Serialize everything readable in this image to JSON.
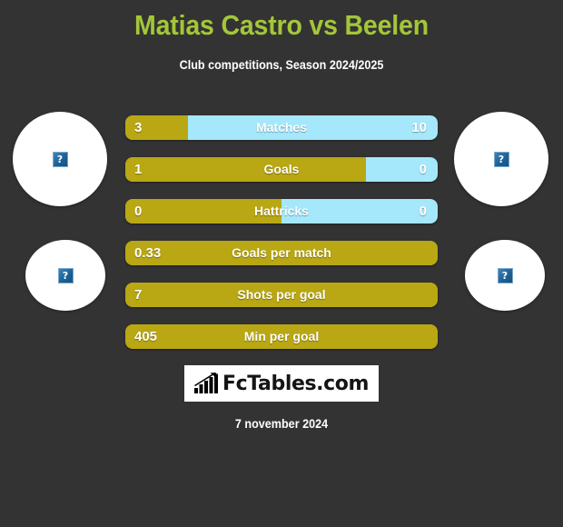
{
  "header": {
    "title": "Matias Castro vs Beelen",
    "subtitle": "Club competitions, Season 2024/2025",
    "title_color": "#a4c639",
    "background_color": "#333333"
  },
  "colors": {
    "home_bar": "#b9a713",
    "away_bar": "#a5e7fb",
    "text": "#ffffff"
  },
  "avatars": [
    {
      "position": "home-top",
      "icon": "broken-image-icon",
      "glyph": "?"
    },
    {
      "position": "away-top",
      "icon": "broken-image-icon",
      "glyph": "?"
    },
    {
      "position": "home-bottom",
      "icon": "broken-image-icon",
      "glyph": "?"
    },
    {
      "position": "away-bottom",
      "icon": "broken-image-icon",
      "glyph": "?"
    }
  ],
  "chart_data": {
    "type": "bar",
    "title": "Matias Castro vs Beelen",
    "subtitle": "Club competitions, Season 2024/2025",
    "orientation": "horizontal-diverging",
    "categories": [
      "Matches",
      "Goals",
      "Hattricks",
      "Goals per match",
      "Shots per goal",
      "Min per goal"
    ],
    "series": [
      {
        "name": "Matias Castro",
        "values": [
          "3",
          "1",
          "0",
          "0.33",
          "7",
          "405"
        ],
        "color": "#b9a713"
      },
      {
        "name": "Beelen",
        "values": [
          "10",
          "0",
          "0",
          "",
          "",
          ""
        ],
        "color": "#a5e7fb"
      }
    ],
    "fill_percent": [
      20,
      77,
      50,
      100,
      100,
      100
    ],
    "grid": false,
    "legend": "none"
  },
  "stats": [
    {
      "label": "Matches",
      "left_value": "3",
      "right_value": "10",
      "fill_percent": 20,
      "has_right": true
    },
    {
      "label": "Goals",
      "left_value": "1",
      "right_value": "0",
      "fill_percent": 77,
      "has_right": true
    },
    {
      "label": "Hattricks",
      "left_value": "0",
      "right_value": "0",
      "fill_percent": 50,
      "has_right": true
    },
    {
      "label": "Goals per match",
      "left_value": "0.33",
      "right_value": "",
      "fill_percent": 100,
      "has_right": false
    },
    {
      "label": "Shots per goal",
      "left_value": "7",
      "right_value": "",
      "fill_percent": 100,
      "has_right": false
    },
    {
      "label": "Min per goal",
      "left_value": "405",
      "right_value": "",
      "fill_percent": 100,
      "has_right": false
    }
  ],
  "logo": {
    "text": "FcTables.com",
    "icon": "bar-chart-growth-icon"
  },
  "footer": {
    "date": "7 november 2024"
  }
}
